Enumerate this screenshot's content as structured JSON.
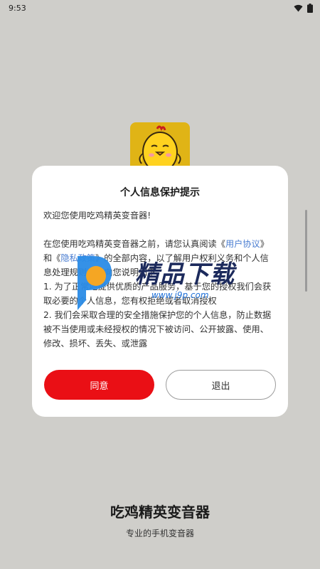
{
  "status_bar": {
    "time": "9:53"
  },
  "dialog": {
    "title": "个人信息保护提示",
    "welcome": "欢迎您使用吃鸡精英变音器!",
    "para_before_link1": "在您使用吃鸡精英变音器之前，请您认真阅读《",
    "link_user_agreement": "用户协议",
    "para_between_links": "》和《",
    "link_privacy_policy": "隐私政策",
    "para_after_links": "》的全部内容，以了解用户权利义务和个人信息处理规则。特向您说明如下：",
    "item_1": "1. 为了正常地提供优质的产品服务，基于您的授权我们会获取必要的个人信息，您有权拒绝或者取消授权",
    "item_2": "2. 我们会采取合理的安全措施保护您的个人信息，防止数据被不当使用或未经授权的情况下被访问、公开披露、使用、修改、损坏、丢失、或泄露",
    "agree_label": "同意",
    "exit_label": "退出"
  },
  "watermark": {
    "brand": "精品下载",
    "url": "www.j9p.com"
  },
  "footer": {
    "app_name": "吃鸡精英变音器",
    "slogan": "专业的手机变音器"
  },
  "colors": {
    "accent": "#ea0f15",
    "link": "#4a7dd1",
    "icon_bg": "#e0b416",
    "page_bg": "#cfceca"
  }
}
